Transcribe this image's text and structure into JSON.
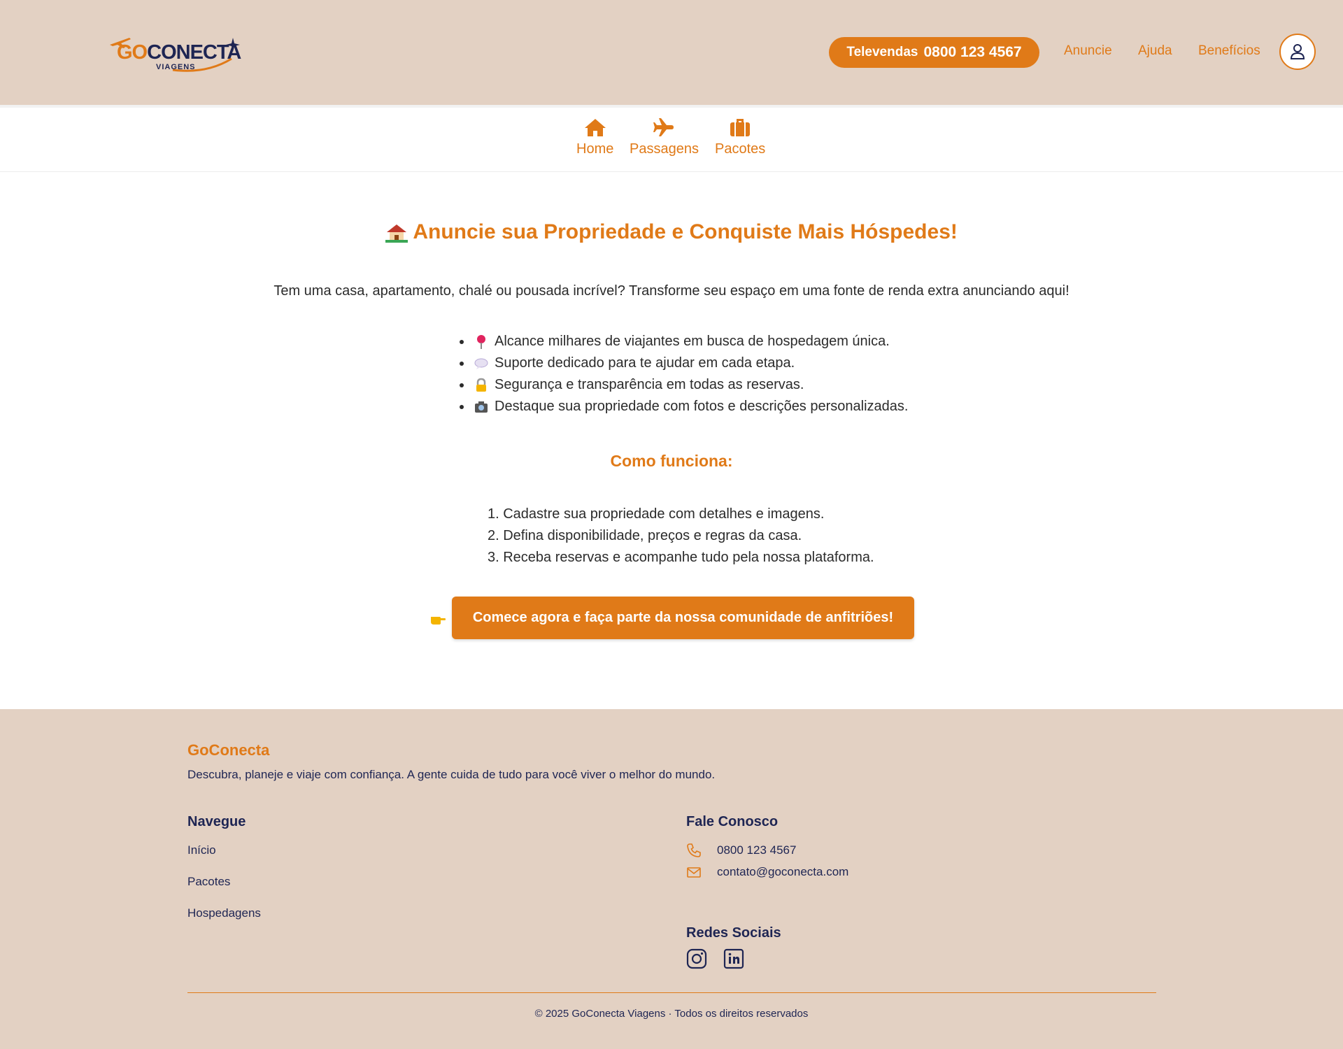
{
  "colors": {
    "accent": "#e07a18",
    "header_bg": "#e3d1c3",
    "navy": "#1e2553",
    "text": "#2b2b2b"
  },
  "header": {
    "logo": {
      "go": "GO",
      "conecta": "CONECTA",
      "sub": "VIAGENS"
    },
    "televendas_label": "Televendas",
    "televendas_number": "0800 123 4567",
    "nav": [
      "Anuncie",
      "Ajuda",
      "Benefícios"
    ],
    "user_icon": "user-icon"
  },
  "subnav": [
    {
      "label": "Home",
      "icon": "home-icon"
    },
    {
      "label": "Passagens",
      "icon": "airplane-icon"
    },
    {
      "label": "Pacotes",
      "icon": "suitcase-icon"
    }
  ],
  "main": {
    "title_icon": "house-with-garden-icon",
    "title": "Anuncie sua Propriedade e Conquiste Mais Hóspedes!",
    "intro": "Tem uma casa, apartamento, chalé ou pousada incrível? Transforme seu espaço em uma fonte de renda extra anunciando aqui!",
    "benefits": [
      {
        "icon": "pin-icon",
        "text": "Alcance milhares de viajantes em busca de hospedagem única."
      },
      {
        "icon": "speech-bubble-icon",
        "text": "Suporte dedicado para te ajudar em cada etapa."
      },
      {
        "icon": "lock-icon",
        "text": "Segurança e transparência em todas as reservas."
      },
      {
        "icon": "camera-icon",
        "text": "Destaque sua propriedade com fotos e descrições personalizadas."
      }
    ],
    "how_title": "Como funciona:",
    "steps": [
      "1. Cadastre sua propriedade com detalhes e imagens.",
      "2. Defina disponibilidade, preços e regras da casa.",
      "3. Receba reservas e acompanhe tudo pela nossa plataforma."
    ],
    "cta_icon": "pointing-hand-icon",
    "cta": "Comece agora e faça parte da nossa comunidade de anfitriões!"
  },
  "footer": {
    "brand": "GoConecta",
    "description": "Descubra, planeje e viaje com confiança. A gente cuida de tudo para você viver o melhor do mundo.",
    "nav_title": "Navegue",
    "nav_links": [
      "Início",
      "Pacotes",
      "Hospedagens"
    ],
    "contact_title": "Fale Conosco",
    "phone": "0800 123 4567",
    "email": "contato@goconecta.com",
    "social_title": "Redes Sociais",
    "social": [
      "instagram-icon",
      "linkedin-icon"
    ],
    "copyright": "© 2025 GoConecta Viagens · Todos os direitos reservados"
  }
}
